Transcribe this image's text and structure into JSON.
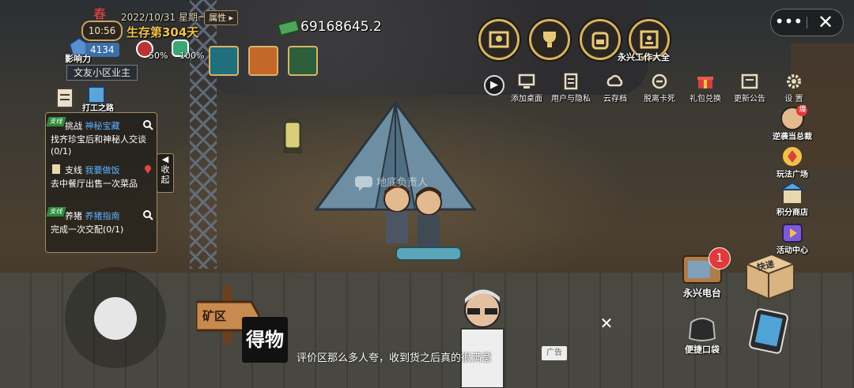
{
  "status": {
    "season_glyph": "春",
    "clock": "10:56",
    "date": "2022/10/31 星期一",
    "attribute_button": "属性 ▸",
    "survival_days": "生存第304天",
    "influence_label": "影响力",
    "influence_value": "4134",
    "hunger": "50%",
    "energy": "100%",
    "title_badge": "文友小区业主",
    "money": "69168645.2"
  },
  "top_buttons": {
    "items": [
      "map-icon",
      "trophy-icon",
      "backpack-icon",
      "work-icon"
    ],
    "work_label": "永兴工作大全"
  },
  "menu": {
    "items": [
      {
        "label": "添加桌面",
        "icon": "add-desktop-icon"
      },
      {
        "label": "用户与隐私",
        "icon": "user-privacy-icon"
      },
      {
        "label": "云存档",
        "icon": "cloud-save-icon"
      },
      {
        "label": "脱离卡死",
        "icon": "unstuck-icon"
      },
      {
        "label": "礼包兑换",
        "icon": "gift-icon"
      },
      {
        "label": "更新公告",
        "icon": "announcement-icon"
      },
      {
        "label": "设 置",
        "icon": "settings-icon"
      }
    ]
  },
  "window": {
    "more": "•••",
    "close": "✕"
  },
  "quests": {
    "top_label": "打工之路",
    "collapse": "收\n起",
    "items": [
      {
        "tag": "支线",
        "kind": "挑战",
        "name": "神秘宝藏",
        "desc": "找齐珍宝后和神秘人交谈(0/1)",
        "icon": "search-icon"
      },
      {
        "tag": "",
        "kind": "支线",
        "name": "我要做饭",
        "desc": "去中餐厅出售一次菜品",
        "icon": "location-pin-icon"
      },
      {
        "tag": "支线",
        "kind": "养猪",
        "name": "养猪指南",
        "desc": "完成一次交配(0/1)",
        "icon": "search-icon"
      }
    ]
  },
  "scene": {
    "npc_label": "地底负责人",
    "sign_label": "矿区"
  },
  "right_buttons": [
    {
      "label": "逆袭当总裁",
      "icon": "ceo-icon",
      "badge": "爆"
    },
    {
      "label": "玩法广场",
      "icon": "gameplay-square-icon"
    },
    {
      "label": "积分商店",
      "icon": "points-shop-icon"
    },
    {
      "label": "活动中心",
      "icon": "event-center-icon"
    }
  ],
  "bottom_right": {
    "tv_label": "永兴电台",
    "tv_badge": "1",
    "crate_label": "快递",
    "bag_label": "便捷口袋"
  },
  "ad": {
    "logo": "得物",
    "text": "评价区那么多人夸，收到货之后真的很满意",
    "badge": "广告",
    "close": "✕"
  }
}
